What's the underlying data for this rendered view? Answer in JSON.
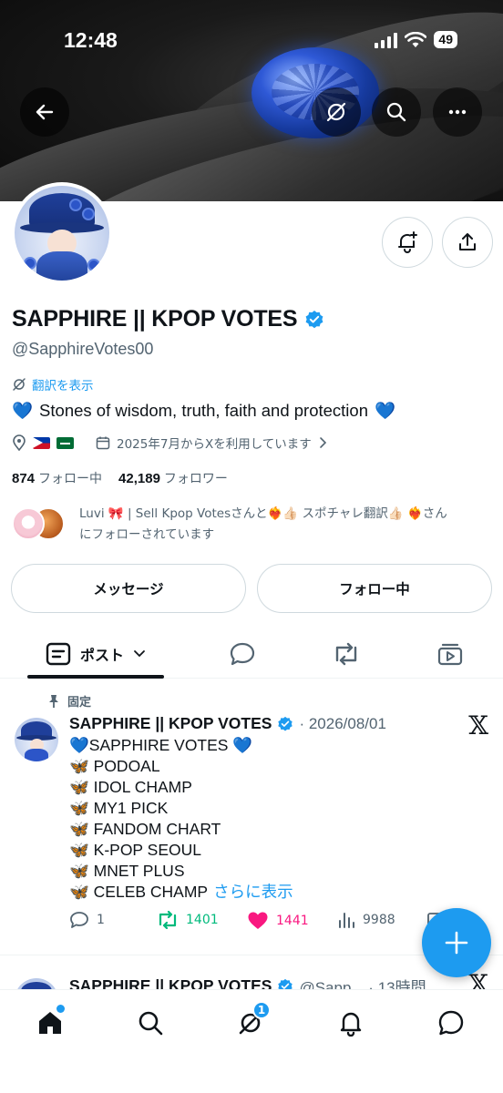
{
  "status_bar": {
    "time": "12:48",
    "battery": "49"
  },
  "profile": {
    "display_name": "SAPPHIRE || KPOP VOTES",
    "handle": "@SapphireVotes00",
    "translate_label": "翻訳を表示",
    "bio": "Stones of wisdom, truth, faith and protection",
    "bio_emoji": "💙",
    "joined": "2025年7月からXを利用しています",
    "following_count": "874",
    "following_label": "フォロー中",
    "followers_count": "42,189",
    "followers_label": "フォロワー",
    "followed_by_line1": "Luvi 🎀 | Sell Kpop Votesさんと❤️‍🔥👍🏻 スポチャレ翻訳👍🏻 ❤️‍🔥さん",
    "followed_by_line2": "にフォローされています",
    "message_button": "メッセージ",
    "following_button": "フォロー中"
  },
  "tabs": {
    "posts_label": "ポスト"
  },
  "pinned_post": {
    "pinned_label": "固定",
    "author": "SAPPHIRE || KPOP VOTES",
    "date": "· 2026/08/01",
    "lines": [
      "💙SAPPHIRE VOTES 💙",
      "🦋 PODOAL",
      "🦋 IDOL CHAMP",
      "🦋 MY1 PICK",
      "🦋 FANDOM CHART",
      "🦋 K-POP SEOUL",
      "🦋 MNET PLUS"
    ],
    "last_line": "🦋 CELEB CHAMP",
    "show_more": "さらに表示",
    "replies": "1",
    "reposts": "1401",
    "likes": "1441",
    "views": "9988"
  },
  "next_post": {
    "author": "SAPPHIRE || KPOP VOTES",
    "meta": "@Sapp... · 13時間"
  },
  "bottom_nav": {
    "communities_badge": "1"
  },
  "colors": {
    "accent": "#1d9bf0",
    "repost": "#00ba7c",
    "like": "#f91880",
    "muted": "#536471"
  }
}
